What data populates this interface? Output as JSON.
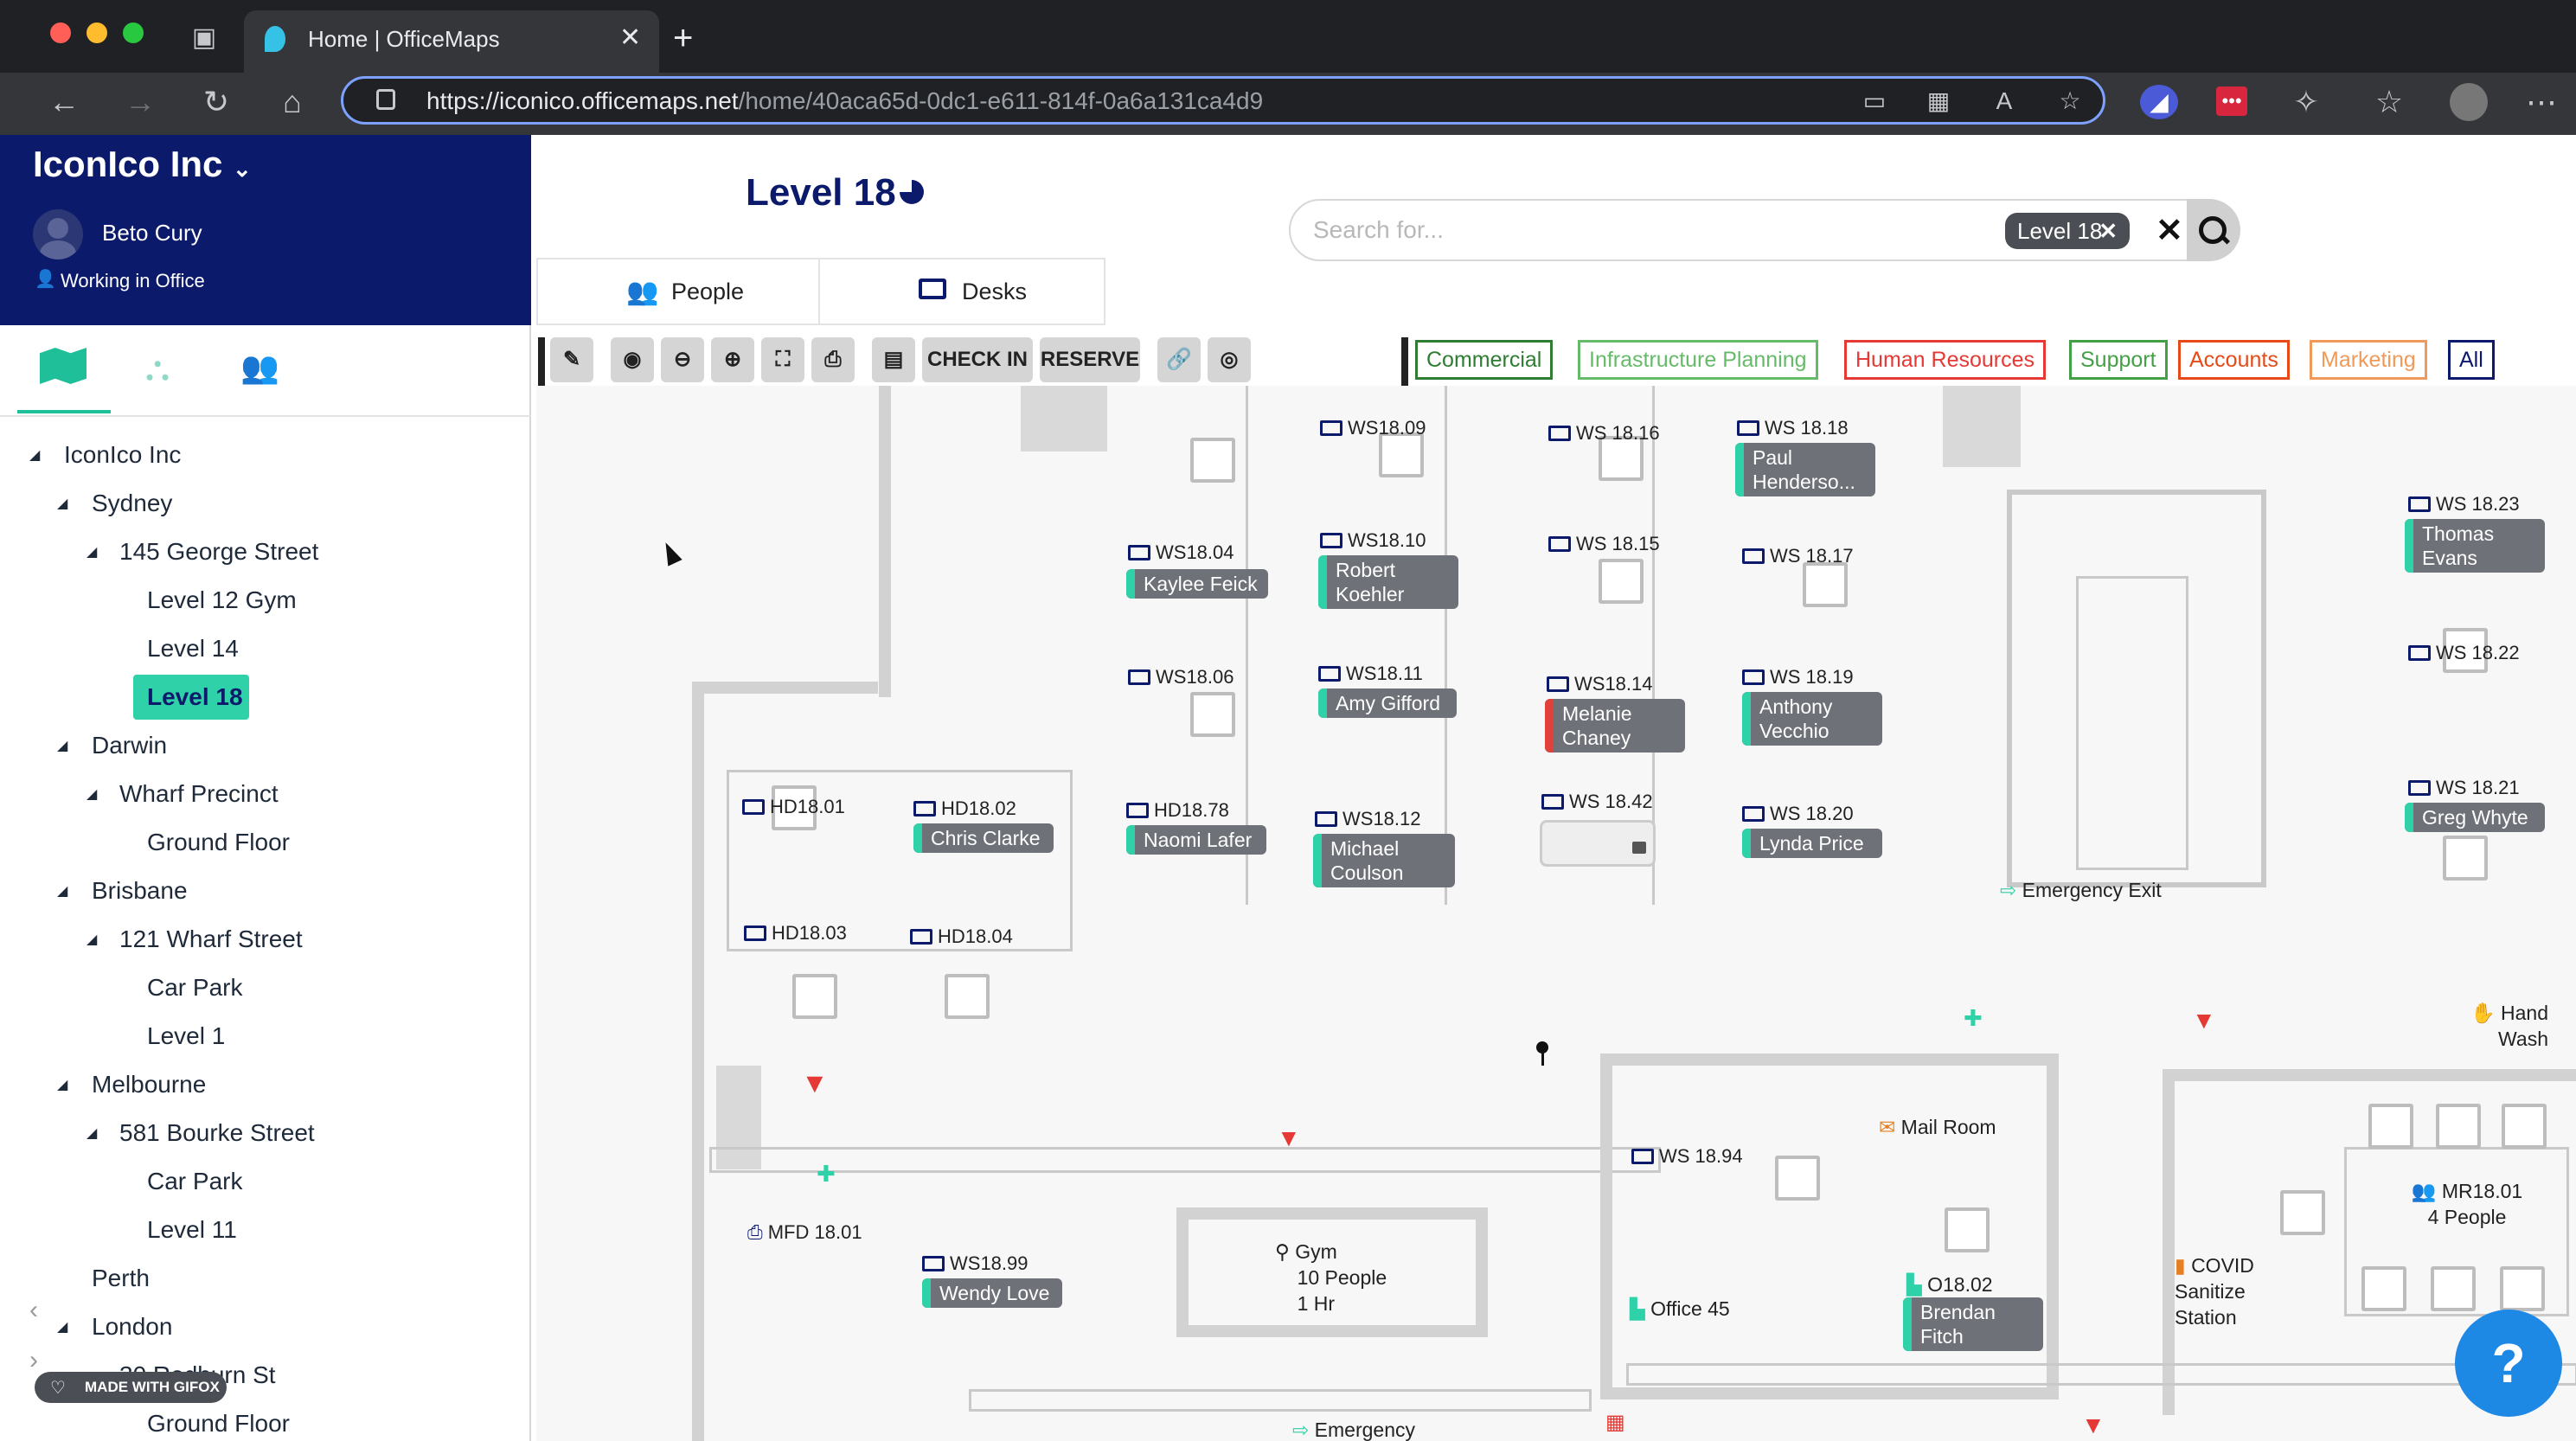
{
  "browser": {
    "tab_title": "Home | OfficeMaps",
    "url_host": "https://iconico.officemaps.net",
    "url_path": "/home/40aca65d-0dc1-e611-814f-0a6a131ca4d9"
  },
  "sidebar": {
    "org_name": "IconIco Inc",
    "user_name": "Beto Cury",
    "status": "Working in Office",
    "tree": [
      {
        "label": "IconIco Inc"
      },
      {
        "label": "Sydney"
      },
      {
        "label": "145 George Street"
      },
      {
        "label": "Level 12 Gym"
      },
      {
        "label": "Level 14"
      },
      {
        "label": "Level 18"
      },
      {
        "label": "Darwin"
      },
      {
        "label": "Wharf Precinct"
      },
      {
        "label": "Ground Floor"
      },
      {
        "label": "Brisbane"
      },
      {
        "label": "121 Wharf Street"
      },
      {
        "label": "Car Park"
      },
      {
        "label": "Level 1"
      },
      {
        "label": "Melbourne"
      },
      {
        "label": "581 Bourke Street"
      },
      {
        "label": "Car Park"
      },
      {
        "label": "Level 11"
      },
      {
        "label": "Perth"
      },
      {
        "label": "London"
      },
      {
        "label": "30 Redburn St"
      },
      {
        "label": "Ground Floor"
      }
    ],
    "gifox_badge": "MADE WITH GIFOX"
  },
  "header": {
    "level_title": "Level 18",
    "search_placeholder": "Search for...",
    "search_chip": "Level 18",
    "tabs": {
      "people": "People",
      "desks": "Desks"
    }
  },
  "toolbar": {
    "check_in": "CHECK IN",
    "reserve": "RESERVE"
  },
  "filters": [
    {
      "label": "Commercial",
      "color": "#2e7d32"
    },
    {
      "label": "Infrastructure Planning",
      "color": "#66bb6a"
    },
    {
      "label": "Human Resources",
      "color": "#e53935"
    },
    {
      "label": "Support",
      "color": "#43a047"
    },
    {
      "label": "Accounts",
      "color": "#e64a19"
    },
    {
      "label": "Marketing",
      "color": "#ef9a5a"
    },
    {
      "label": "All",
      "color": "#0c1a6b"
    }
  ],
  "desks": {
    "ws1809": "WS18.09",
    "ws1816": "WS 18.16",
    "ws1818": "WS 18.18",
    "ws1804": "WS18.04",
    "ws1810": "WS18.10",
    "ws1815": "WS 18.15",
    "ws1817": "WS 18.17",
    "ws1806": "WS18.06",
    "ws1811": "WS18.11",
    "ws1814": "WS18.14",
    "ws1819": "WS 18.19",
    "hd1801": "HD18.01",
    "hd1802": "HD18.02",
    "hd1878": "HD18.78",
    "ws1812": "WS18.12",
    "ws1842": "WS 18.42",
    "ws1820": "WS 18.20",
    "hd1803": "HD18.03",
    "hd1804": "HD18.04",
    "ws1823": "WS 18.23",
    "ws1822": "WS 18.22",
    "ws1821": "WS 18.21",
    "ws1894": "WS 18.94",
    "mfd": "MFD 18.01",
    "ws1899": "WS18.99"
  },
  "people": {
    "paul": "Paul Henderso...",
    "kaylee": "Kaylee Feick",
    "robert": "Robert Koehler",
    "amy": "Amy Gifford",
    "melanie": "Melanie Chaney",
    "anthony": "Anthony Vecchio",
    "chris": "Chris Clarke",
    "naomi": "Naomi Lafer",
    "michael": "Michael Coulson",
    "lynda": "Lynda Price",
    "thomas": "Thomas Evans",
    "greg": "Greg Whyte",
    "wendy": "Wendy Love",
    "brendan": "Brendan Fitch"
  },
  "rooms": {
    "emergency_exit": "Emergency Exit",
    "hand_wash": "Hand Wash",
    "mail_room": "Mail Room",
    "mr": "MR18.01",
    "mr_people": "4 People",
    "gym": "Gym",
    "gym_people": "10 People",
    "gym_time": "1 Hr",
    "office45": "Office 45",
    "o1802": "O18.02",
    "covid": "COVID Sanitize Station",
    "emergency_bottom": "Emergency"
  },
  "help_button": "?"
}
